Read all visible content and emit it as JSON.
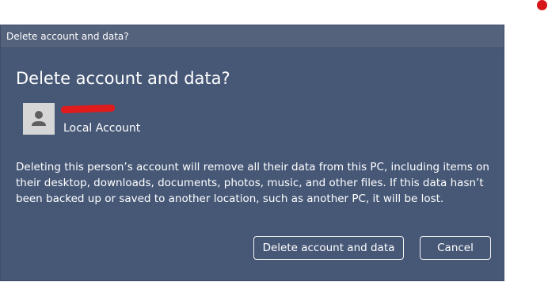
{
  "window": {
    "title": "Delete account and data?"
  },
  "dialog": {
    "heading": "Delete account and data?",
    "account": {
      "avatar_icon": "person-icon",
      "type": "Local Account"
    },
    "message": "Deleting this person’s account will remove all their data from this PC, including items on their desktop, downloads, documents, photos, music, and other files. If this data hasn’t been backed up or saved to another location, such as another PC, it will be lost.",
    "buttons": {
      "delete_label": "Delete account and data",
      "cancel_label": "Cancel"
    }
  },
  "colors": {
    "dialog_background": "#475877",
    "titlebar_background": "#54627c",
    "redaction": "#e01b1b",
    "red_dot": "#d6161a"
  }
}
